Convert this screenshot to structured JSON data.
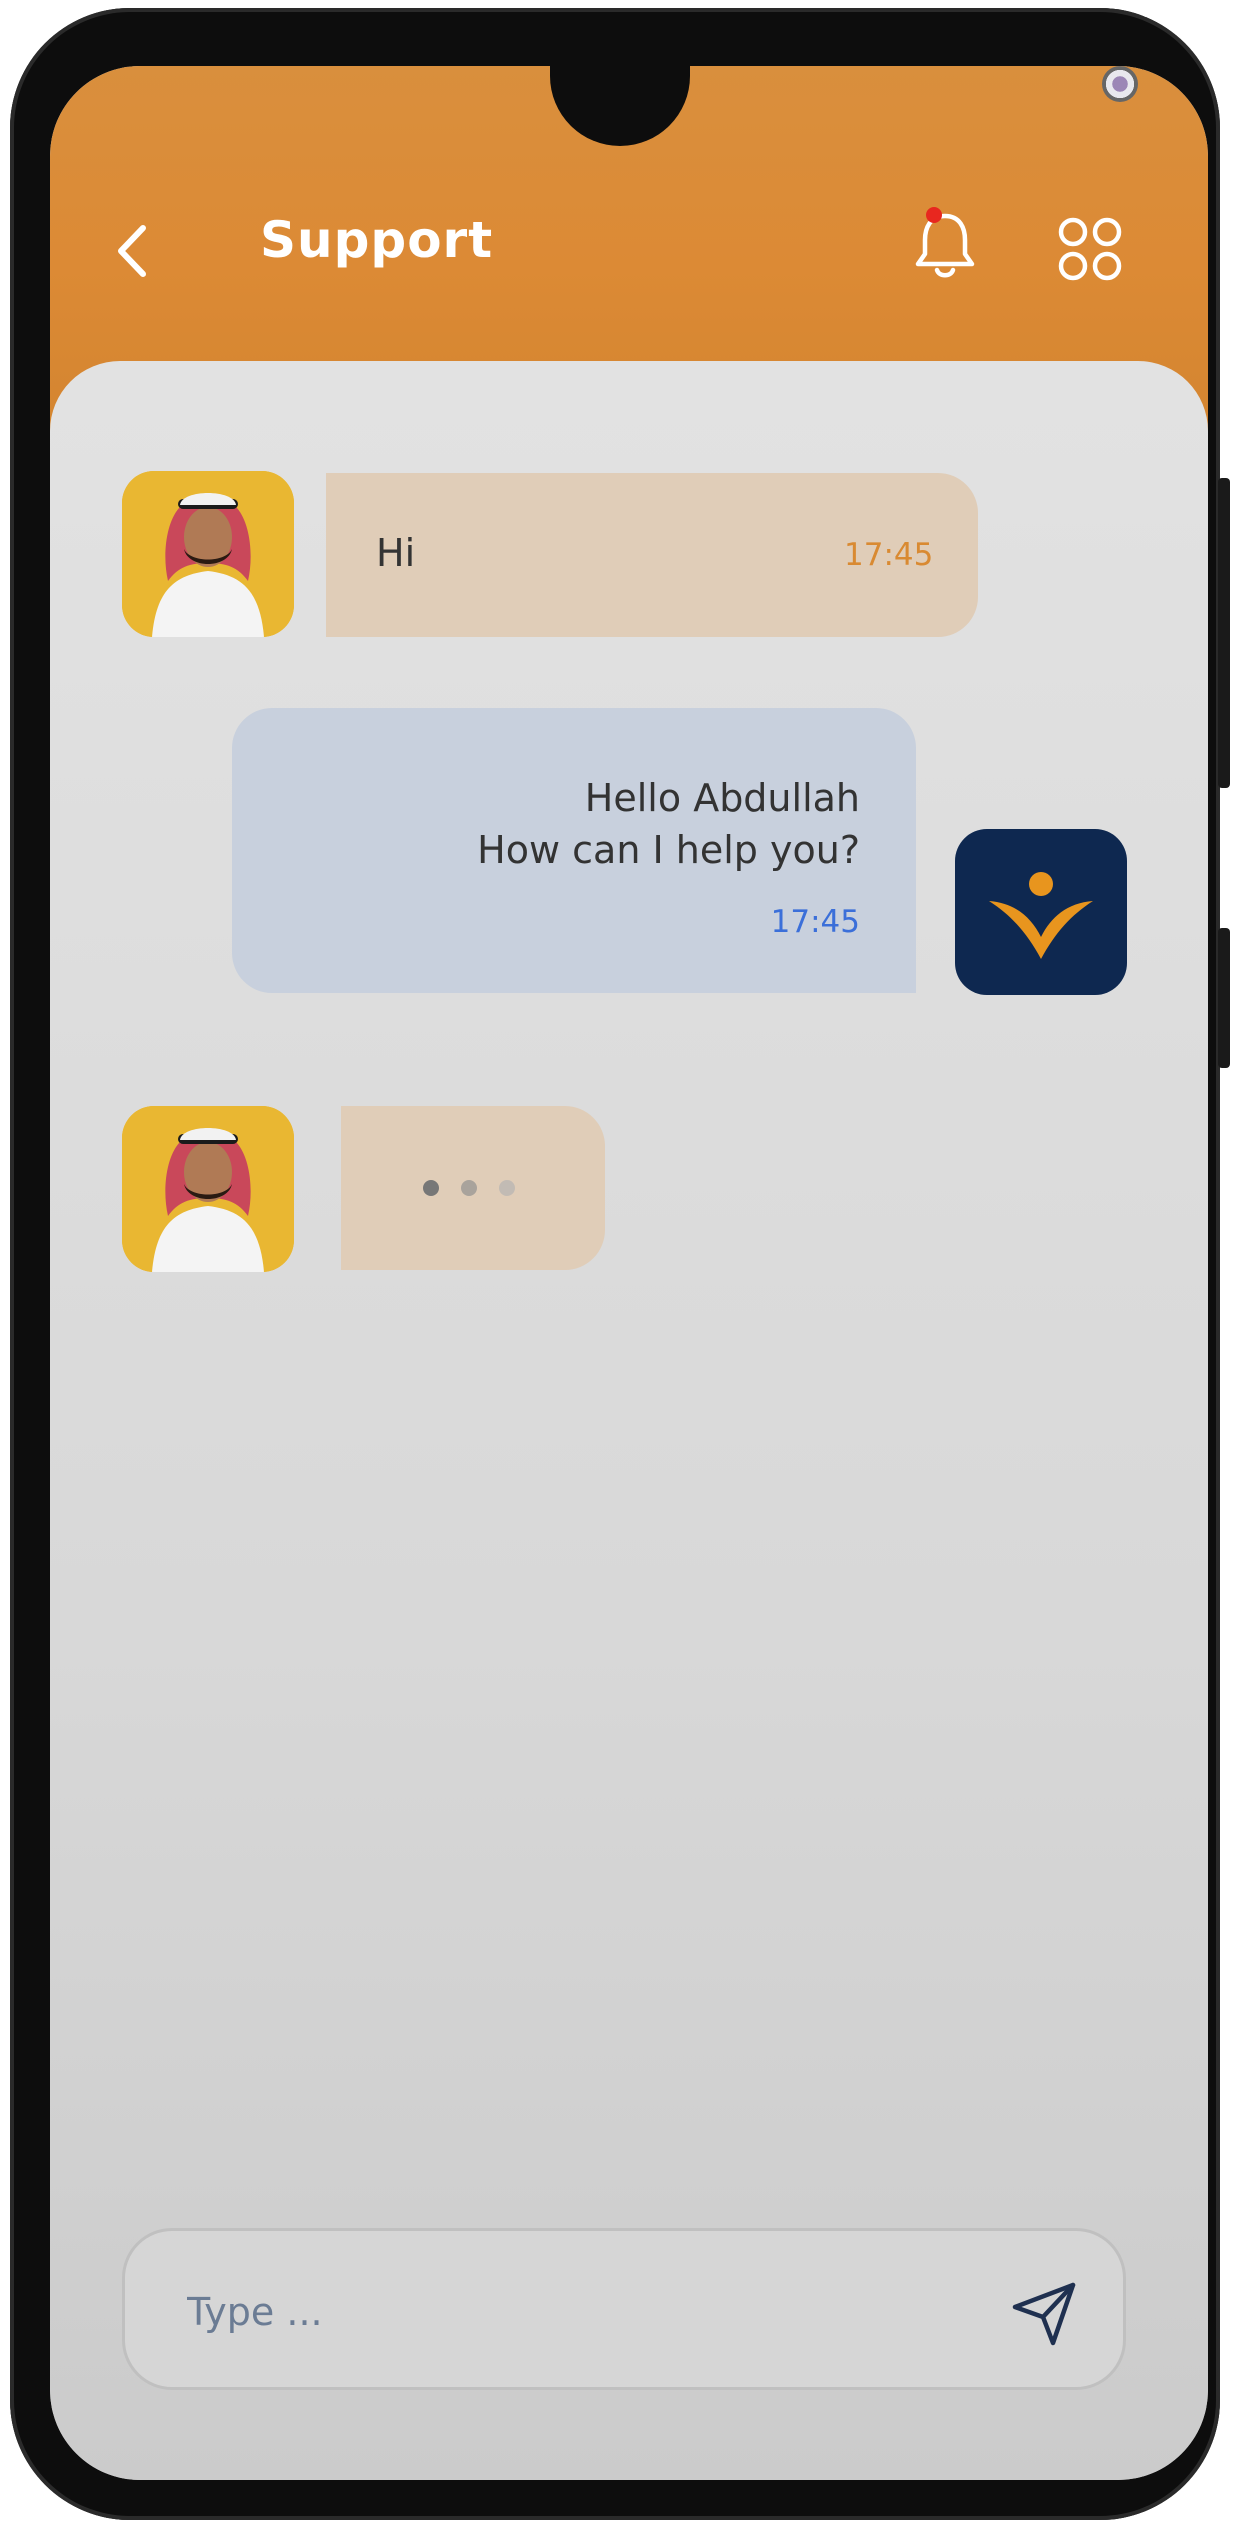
{
  "header": {
    "title": "Support",
    "accent_color": "#dc8a35",
    "icons": {
      "back": "chevron-left-icon",
      "notifications": "bell-icon",
      "menu": "grid-icon"
    },
    "notification_dot_color": "#e8271f"
  },
  "messages": [
    {
      "from": "user",
      "text": "Hi",
      "time": "17:45"
    },
    {
      "from": "support",
      "lines": [
        "Hello Abdullah",
        "How can I help you?"
      ],
      "time": "17:45"
    },
    {
      "from": "user",
      "typing": true
    }
  ],
  "composer": {
    "placeholder": "Type ...",
    "send_icon": "send-icon"
  },
  "colors": {
    "incoming_bubble": "#e0cdb8",
    "outgoing_bubble": "#c8d0dd",
    "incoming_time": "#d98a32",
    "outgoing_time": "#3b6fd9",
    "support_logo_bg": "#0e2850"
  }
}
